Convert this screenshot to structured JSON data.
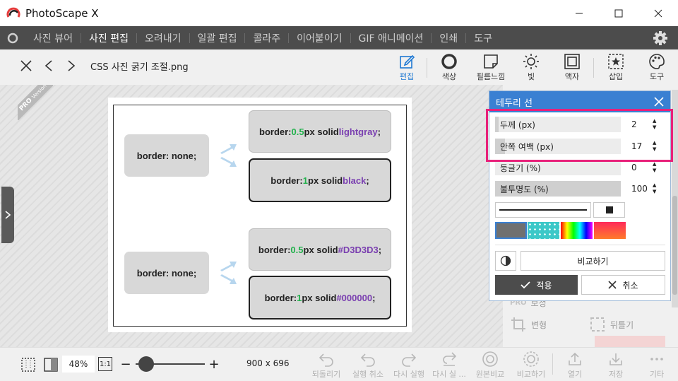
{
  "app": {
    "title": "PhotoScape X"
  },
  "window_controls": {
    "minimize": "—",
    "maximize": "☐",
    "close": "✕"
  },
  "nav": {
    "items": [
      {
        "label": "사진 뷰어",
        "active": false
      },
      {
        "label": "사진 편집",
        "active": true
      },
      {
        "label": "오려내기",
        "active": false
      },
      {
        "label": "일괄 편집",
        "active": false
      },
      {
        "label": "콜라주",
        "active": false
      },
      {
        "label": "이어붙이기",
        "active": false
      },
      {
        "label": "GIF 애니메이션",
        "active": false
      },
      {
        "label": "인쇄",
        "active": false
      },
      {
        "label": "도구",
        "active": false
      }
    ]
  },
  "toolbar": {
    "filename": "CSS 사진 굵기 조절.png",
    "tools": {
      "edit": "편집",
      "color": "색상",
      "film": "필름느낌",
      "light": "빛",
      "frame": "액자",
      "insert": "삽입",
      "tools": "도구"
    }
  },
  "canvas": {
    "pro_badge": "PRO",
    "pro_sub": "Version",
    "boxes": {
      "none_top": "border: none;",
      "none_bottom": "border: none;",
      "b1_prefix": "border: ",
      "b1_num": "0.5",
      "b1_mid": "px solid ",
      "b1_val": "lightgray",
      "b1_end": ";",
      "b2_prefix": "border: ",
      "b2_num": "1",
      "b2_mid": "px solid ",
      "b2_val": "black",
      "b2_end": ";",
      "b3_prefix": "border: ",
      "b3_num": "0.5",
      "b3_mid": "px solid ",
      "b3_val": "#D3D3D3",
      "b3_end": ";",
      "b4_prefix": "border: ",
      "b4_num": "1",
      "b4_mid": "px solid ",
      "b4_val": "#000000",
      "b4_end": ";"
    }
  },
  "panel_bg": {
    "correction": "보정",
    "transform": "변형",
    "flip": "뒤틀기",
    "pro": "PRO"
  },
  "dialog": {
    "title": "테두리 선",
    "rows": [
      {
        "label": "두께 (px)",
        "value": "2",
        "level": 0.03
      },
      {
        "label": "안쪽 여백 (px)",
        "value": "17",
        "level": 0.08
      },
      {
        "label": "둥글기 (%)",
        "value": "0",
        "level": 0.0
      },
      {
        "label": "불투명도 (%)",
        "value": "100",
        "level": 1.0
      }
    ],
    "compare": "비교하기",
    "apply": "적용",
    "cancel": "취소",
    "colors": {
      "accent": "#3a80d2",
      "highlight": "#e8217a"
    }
  },
  "bottom": {
    "zoom": "48%",
    "one_to_one": "1:1",
    "minus": "−",
    "plus": "+",
    "zoom_level": 0.15,
    "dimensions": "900 x 696",
    "actions": {
      "revert": "되돌리기",
      "undo": "실행 취소",
      "redo": "다시 실행",
      "redo_more": "다시 실 ...",
      "original_compare": "원본비교",
      "compare": "비교하기",
      "open": "열기",
      "save": "저장",
      "more": "기타"
    }
  }
}
